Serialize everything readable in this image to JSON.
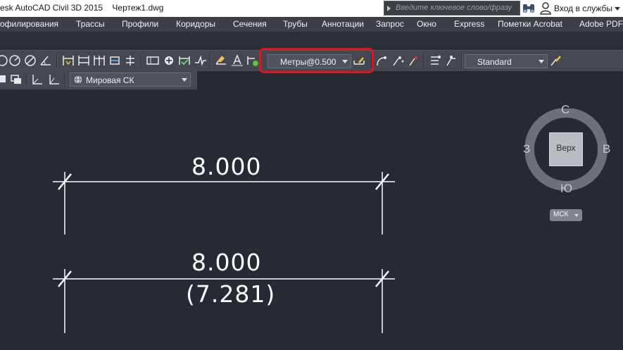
{
  "titlebar": {
    "app_title": "esk AutoCAD Civil 3D 2015",
    "document": "Чертеж1.dwg",
    "search_placeholder": "Введите ключевое слово/фразу",
    "sign_in": "Вход в службы"
  },
  "menubar": {
    "items": [
      "офилирования",
      "Трассы",
      "Профили",
      "Коридоры",
      "Сечения",
      "Трубы",
      "Аннотации",
      "Запрос",
      "Окно",
      "Express",
      "Пометки Acrobat",
      "Adobe PDF"
    ]
  },
  "toolbar": {
    "dimstyle_value": "Метры@0.500",
    "textstyle_value": "Standard",
    "ucs_value": "Мировая СК"
  },
  "drawing": {
    "dim1_text": "8.000",
    "dim2_text": "8.000",
    "dim2_alt_text": "(7.281)"
  },
  "viewcube": {
    "north": "С",
    "south": "Ю",
    "west": "З",
    "east": "В",
    "top_face": "Верх",
    "ucs_badge": "МСК"
  },
  "colors": {
    "background": "#252a33",
    "highlight": "#e0141b"
  }
}
